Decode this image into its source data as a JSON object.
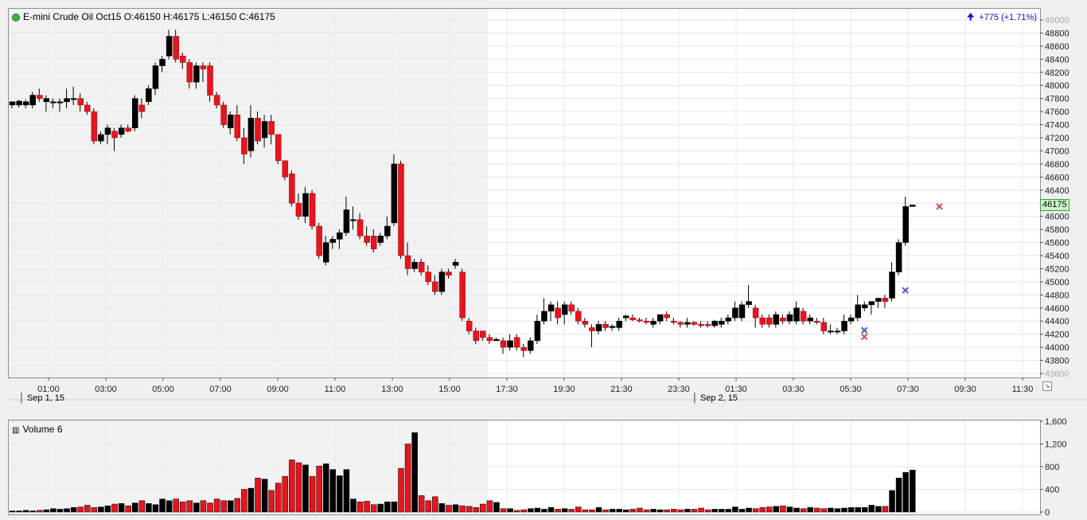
{
  "price_panel": {
    "title": "E-mini Crude Oil Oct15 O:46150 H:46175 L:46150 C:46175",
    "change_text": "+775 (+1.71%)",
    "last_price_tag": "46175",
    "status_color": "#3cb43c"
  },
  "volume_panel": {
    "title": "Volume 6"
  },
  "dates": {
    "day1": "Sep 1, 15",
    "day2": "Sep 2, 15"
  },
  "colors": {
    "up": "#000000",
    "down": "#e8141e",
    "marker_blue": "#4a5ad8",
    "marker_red": "#e04a4a",
    "session_shade": "#f2f2f2"
  },
  "chart_data": [
    {
      "type": "candlestick",
      "title": "E-mini Crude Oil Oct15",
      "ylim": [
        43600,
        49000
      ],
      "y_ticks": [
        43600,
        43800,
        44000,
        44200,
        44400,
        44600,
        44800,
        45000,
        45200,
        45400,
        45600,
        45800,
        46000,
        46200,
        46400,
        46600,
        46800,
        47000,
        47200,
        47400,
        47600,
        47800,
        48000,
        48200,
        48400,
        48600,
        48800,
        49000
      ],
      "x_ticks": [
        "01:00",
        "03:00",
        "05:00",
        "07:00",
        "09:00",
        "11:00",
        "13:00",
        "15:00",
        "17:30",
        "19:30",
        "21:30",
        "23:30",
        "01:30",
        "03:30",
        "05:30",
        "07:30",
        "09:30",
        "11:30"
      ],
      "grid": true,
      "candles": [
        {
          "o": 47700,
          "h": 47750,
          "l": 47650,
          "c": 47750
        },
        {
          "o": 47700,
          "h": 47780,
          "l": 47660,
          "c": 47760
        },
        {
          "o": 47700,
          "h": 47780,
          "l": 47650,
          "c": 47750
        },
        {
          "o": 47700,
          "h": 47900,
          "l": 47650,
          "c": 47850
        },
        {
          "o": 47850,
          "h": 47950,
          "l": 47750,
          "c": 47800
        },
        {
          "o": 47750,
          "h": 47850,
          "l": 47600,
          "c": 47800
        },
        {
          "o": 47750,
          "h": 47800,
          "l": 47650,
          "c": 47750
        },
        {
          "o": 47750,
          "h": 47800,
          "l": 47600,
          "c": 47750
        },
        {
          "o": 47750,
          "h": 47950,
          "l": 47650,
          "c": 47800
        },
        {
          "o": 47800,
          "h": 47980,
          "l": 47700,
          "c": 47800
        },
        {
          "o": 47800,
          "h": 47880,
          "l": 47600,
          "c": 47700
        },
        {
          "o": 47700,
          "h": 47750,
          "l": 47550,
          "c": 47600
        },
        {
          "o": 47600,
          "h": 47650,
          "l": 47100,
          "c": 47150
        },
        {
          "o": 47150,
          "h": 47300,
          "l": 47100,
          "c": 47250
        },
        {
          "o": 47250,
          "h": 47400,
          "l": 47100,
          "c": 47350
        },
        {
          "o": 47300,
          "h": 47350,
          "l": 47000,
          "c": 47200
        },
        {
          "o": 47250,
          "h": 47400,
          "l": 47200,
          "c": 47350
        },
        {
          "o": 47350,
          "h": 47400,
          "l": 47280,
          "c": 47300
        },
        {
          "o": 47350,
          "h": 47850,
          "l": 47300,
          "c": 47800
        },
        {
          "o": 47700,
          "h": 47800,
          "l": 47500,
          "c": 47600
        },
        {
          "o": 47750,
          "h": 48000,
          "l": 47700,
          "c": 47950
        },
        {
          "o": 47950,
          "h": 48350,
          "l": 47850,
          "c": 48300
        },
        {
          "o": 48300,
          "h": 48450,
          "l": 48200,
          "c": 48400
        },
        {
          "o": 48450,
          "h": 48850,
          "l": 48400,
          "c": 48750
        },
        {
          "o": 48750,
          "h": 48850,
          "l": 48350,
          "c": 48400
        },
        {
          "o": 48450,
          "h": 48500,
          "l": 48250,
          "c": 48350
        },
        {
          "o": 48350,
          "h": 48400,
          "l": 47950,
          "c": 48050
        },
        {
          "o": 48050,
          "h": 48350,
          "l": 47950,
          "c": 48300
        },
        {
          "o": 48300,
          "h": 48350,
          "l": 48050,
          "c": 48250
        },
        {
          "o": 48300,
          "h": 48350,
          "l": 47750,
          "c": 47850
        },
        {
          "o": 47850,
          "h": 47900,
          "l": 47650,
          "c": 47700
        },
        {
          "o": 47700,
          "h": 47750,
          "l": 47350,
          "c": 47400
        },
        {
          "o": 47350,
          "h": 47600,
          "l": 47250,
          "c": 47550
        },
        {
          "o": 47550,
          "h": 47700,
          "l": 47150,
          "c": 47200
        },
        {
          "o": 47200,
          "h": 47350,
          "l": 46800,
          "c": 46950
        },
        {
          "o": 47000,
          "h": 47700,
          "l": 46900,
          "c": 47500
        },
        {
          "o": 47500,
          "h": 47600,
          "l": 47100,
          "c": 47150
        },
        {
          "o": 47200,
          "h": 47550,
          "l": 47050,
          "c": 47450
        },
        {
          "o": 47450,
          "h": 47550,
          "l": 47100,
          "c": 47250
        },
        {
          "o": 47250,
          "h": 47250,
          "l": 46800,
          "c": 46850
        },
        {
          "o": 46850,
          "h": 46850,
          "l": 46550,
          "c": 46600
        },
        {
          "o": 46650,
          "h": 46700,
          "l": 46150,
          "c": 46200
        },
        {
          "o": 46200,
          "h": 46350,
          "l": 45950,
          "c": 46000
        },
        {
          "o": 46000,
          "h": 46450,
          "l": 45900,
          "c": 46350
        },
        {
          "o": 46350,
          "h": 46400,
          "l": 45800,
          "c": 45850
        },
        {
          "o": 45850,
          "h": 45900,
          "l": 45350,
          "c": 45400
        },
        {
          "o": 45300,
          "h": 45700,
          "l": 45250,
          "c": 45600
        },
        {
          "o": 45600,
          "h": 45700,
          "l": 45500,
          "c": 45650
        },
        {
          "o": 45650,
          "h": 45800,
          "l": 45500,
          "c": 45750
        },
        {
          "o": 45750,
          "h": 46300,
          "l": 45700,
          "c": 46100
        },
        {
          "o": 45950,
          "h": 46150,
          "l": 45800,
          "c": 45950
        },
        {
          "o": 45950,
          "h": 46050,
          "l": 45650,
          "c": 45700
        },
        {
          "o": 45700,
          "h": 45850,
          "l": 45550,
          "c": 45600
        },
        {
          "o": 45700,
          "h": 45800,
          "l": 45450,
          "c": 45500
        },
        {
          "o": 45600,
          "h": 45750,
          "l": 45550,
          "c": 45700
        },
        {
          "o": 45700,
          "h": 46000,
          "l": 45650,
          "c": 45850
        },
        {
          "o": 45900,
          "h": 46950,
          "l": 45850,
          "c": 46800
        },
        {
          "o": 46800,
          "h": 46850,
          "l": 45350,
          "c": 45400
        },
        {
          "o": 45400,
          "h": 45600,
          "l": 45100,
          "c": 45200
        },
        {
          "o": 45200,
          "h": 45350,
          "l": 45150,
          "c": 45300
        },
        {
          "o": 45300,
          "h": 45350,
          "l": 45100,
          "c": 45150
        },
        {
          "o": 45150,
          "h": 45250,
          "l": 44950,
          "c": 45000
        },
        {
          "o": 45000,
          "h": 45100,
          "l": 44800,
          "c": 44850
        },
        {
          "o": 44850,
          "h": 45200,
          "l": 44800,
          "c": 45150
        },
        {
          "o": 45150,
          "h": 45200,
          "l": 45050,
          "c": 45100
        },
        {
          "o": 45250,
          "h": 45350,
          "l": 45200,
          "c": 45300
        },
        {
          "o": 45150,
          "h": 45200,
          "l": 44400,
          "c": 44450
        },
        {
          "o": 44400,
          "h": 44450,
          "l": 44200,
          "c": 44250
        },
        {
          "o": 44250,
          "h": 44300,
          "l": 44050,
          "c": 44100
        },
        {
          "o": 44250,
          "h": 44250,
          "l": 44100,
          "c": 44150
        },
        {
          "o": 44150,
          "h": 44200,
          "l": 44050,
          "c": 44100
        },
        {
          "o": 44100,
          "h": 44150,
          "l": 44100,
          "c": 44120
        },
        {
          "o": 44100,
          "h": 44150,
          "l": 43900,
          "c": 44000
        },
        {
          "o": 44000,
          "h": 44200,
          "l": 43950,
          "c": 44100
        },
        {
          "o": 44150,
          "h": 44200,
          "l": 43950,
          "c": 44000
        },
        {
          "o": 44000,
          "h": 44050,
          "l": 43850,
          "c": 43950
        },
        {
          "o": 43950,
          "h": 44150,
          "l": 43900,
          "c": 44100
        },
        {
          "o": 44100,
          "h": 44500,
          "l": 44050,
          "c": 44400
        },
        {
          "o": 44400,
          "h": 44750,
          "l": 44350,
          "c": 44550
        },
        {
          "o": 44550,
          "h": 44700,
          "l": 44400,
          "c": 44650
        },
        {
          "o": 44600,
          "h": 44700,
          "l": 44350,
          "c": 44450
        },
        {
          "o": 44500,
          "h": 44700,
          "l": 44350,
          "c": 44650
        },
        {
          "o": 44650,
          "h": 44700,
          "l": 44500,
          "c": 44550
        },
        {
          "o": 44550,
          "h": 44600,
          "l": 44350,
          "c": 44400
        },
        {
          "o": 44400,
          "h": 44450,
          "l": 44300,
          "c": 44350
        },
        {
          "o": 44300,
          "h": 44350,
          "l": 44000,
          "c": 44250
        },
        {
          "o": 44250,
          "h": 44400,
          "l": 44200,
          "c": 44350
        },
        {
          "o": 44350,
          "h": 44400,
          "l": 44250,
          "c": 44300
        },
        {
          "o": 44300,
          "h": 44350,
          "l": 44250,
          "c": 44320
        },
        {
          "o": 44300,
          "h": 44450,
          "l": 44250,
          "c": 44400
        },
        {
          "o": 44450,
          "h": 44500,
          "l": 44400,
          "c": 44480
        },
        {
          "o": 44450,
          "h": 44500,
          "l": 44400,
          "c": 44420
        },
        {
          "o": 44420,
          "h": 44450,
          "l": 44380,
          "c": 44400
        },
        {
          "o": 44400,
          "h": 44450,
          "l": 44350,
          "c": 44380
        },
        {
          "o": 44350,
          "h": 44450,
          "l": 44300,
          "c": 44400
        },
        {
          "o": 44400,
          "h": 44500,
          "l": 44350,
          "c": 44500
        },
        {
          "o": 44500,
          "h": 44550,
          "l": 44400,
          "c": 44450
        },
        {
          "o": 44400,
          "h": 44450,
          "l": 44350,
          "c": 44380
        },
        {
          "o": 44380,
          "h": 44400,
          "l": 44300,
          "c": 44350
        },
        {
          "o": 44350,
          "h": 44450,
          "l": 44300,
          "c": 44380
        },
        {
          "o": 44380,
          "h": 44400,
          "l": 44330,
          "c": 44350
        },
        {
          "o": 44350,
          "h": 44400,
          "l": 44300,
          "c": 44330
        },
        {
          "o": 44350,
          "h": 44400,
          "l": 44300,
          "c": 44330
        },
        {
          "o": 44330,
          "h": 44420,
          "l": 44300,
          "c": 44400
        },
        {
          "o": 44350,
          "h": 44450,
          "l": 44300,
          "c": 44400
        },
        {
          "o": 44400,
          "h": 44500,
          "l": 44350,
          "c": 44450
        },
        {
          "o": 44450,
          "h": 44700,
          "l": 44400,
          "c": 44600
        },
        {
          "o": 44450,
          "h": 44700,
          "l": 44400,
          "c": 44650
        },
        {
          "o": 44650,
          "h": 44950,
          "l": 44600,
          "c": 44700
        },
        {
          "o": 44600,
          "h": 44650,
          "l": 44300,
          "c": 44450
        },
        {
          "o": 44450,
          "h": 44500,
          "l": 44300,
          "c": 44350
        },
        {
          "o": 44450,
          "h": 44500,
          "l": 44300,
          "c": 44350
        },
        {
          "o": 44350,
          "h": 44550,
          "l": 44300,
          "c": 44500
        },
        {
          "o": 44450,
          "h": 44500,
          "l": 44350,
          "c": 44400
        },
        {
          "o": 44400,
          "h": 44550,
          "l": 44350,
          "c": 44500
        },
        {
          "o": 44400,
          "h": 44700,
          "l": 44350,
          "c": 44600
        },
        {
          "o": 44550,
          "h": 44600,
          "l": 44350,
          "c": 44400
        },
        {
          "o": 44400,
          "h": 44500,
          "l": 44350,
          "c": 44450
        },
        {
          "o": 44400,
          "h": 44450,
          "l": 44350,
          "c": 44380
        },
        {
          "o": 44380,
          "h": 44450,
          "l": 44200,
          "c": 44250
        },
        {
          "o": 44250,
          "h": 44350,
          "l": 44200,
          "c": 44250
        },
        {
          "o": 44250,
          "h": 44300,
          "l": 44200,
          "c": 44250
        },
        {
          "o": 44250,
          "h": 44500,
          "l": 44200,
          "c": 44400
        },
        {
          "o": 44400,
          "h": 44500,
          "l": 44350,
          "c": 44450
        },
        {
          "o": 44450,
          "h": 44800,
          "l": 44400,
          "c": 44650
        },
        {
          "o": 44600,
          "h": 44700,
          "l": 44550,
          "c": 44650
        },
        {
          "o": 44650,
          "h": 44700,
          "l": 44500,
          "c": 44700
        },
        {
          "o": 44700,
          "h": 44750,
          "l": 44600,
          "c": 44750
        },
        {
          "o": 44750,
          "h": 44800,
          "l": 44600,
          "c": 44700
        },
        {
          "o": 44750,
          "h": 45300,
          "l": 44700,
          "c": 45150
        },
        {
          "o": 45150,
          "h": 45650,
          "l": 45100,
          "c": 45600
        },
        {
          "o": 45600,
          "h": 46300,
          "l": 45550,
          "c": 46150
        },
        {
          "o": 46150,
          "h": 46175,
          "l": 46150,
          "c": 46175
        }
      ]
    },
    {
      "type": "bar",
      "title": "Volume 6",
      "ylim": [
        0,
        1600
      ],
      "y_ticks": [
        0,
        400,
        800,
        1200,
        1600
      ],
      "y_tick_labels": [
        "0",
        "400",
        "800",
        "1,200",
        "1,600"
      ],
      "values": [
        20,
        20,
        30,
        20,
        30,
        40,
        60,
        50,
        60,
        80,
        90,
        120,
        80,
        90,
        110,
        140,
        150,
        110,
        160,
        200,
        150,
        130,
        230,
        200,
        230,
        180,
        200,
        160,
        200,
        160,
        230,
        200,
        200,
        240,
        400,
        420,
        600,
        580,
        380,
        510,
        630,
        920,
        870,
        830,
        630,
        810,
        850,
        750,
        640,
        750,
        230,
        180,
        190,
        130,
        140,
        180,
        180,
        770,
        1200,
        1400,
        290,
        200,
        270,
        150,
        120,
        130,
        110,
        100,
        80,
        140,
        200,
        170,
        60,
        60,
        30,
        40,
        60,
        70,
        50,
        80,
        50,
        60,
        50,
        90,
        40,
        40,
        80,
        40,
        50,
        50,
        40,
        50,
        70,
        40,
        50,
        40,
        40,
        50,
        40,
        50,
        50,
        70,
        40,
        50,
        50,
        50,
        90,
        50,
        70,
        60,
        80,
        90,
        100,
        110,
        90,
        70,
        60,
        80,
        70,
        60,
        70,
        60,
        70,
        80,
        80,
        80,
        120,
        100,
        100,
        380,
        600,
        700,
        740
      ]
    }
  ]
}
